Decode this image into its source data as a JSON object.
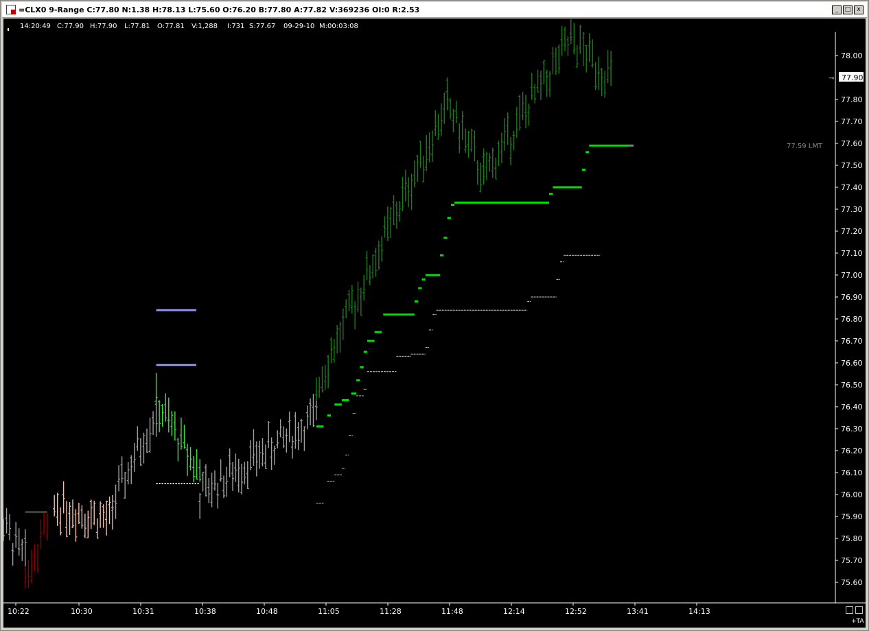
{
  "window": {
    "title": "=CLX0 9-Range C:77.80 N:1.38 H:78.13 L:75.60 O:76.20 B:77.80 A:77.82 V:369236 OI:0 R:2.53",
    "minimize_label": "_",
    "maximize_label": "□",
    "close_label": "x",
    "ta_label": "+TA"
  },
  "info_bar": {
    "time": "14:20:49",
    "close": "C:77.90",
    "high": "H:77.90",
    "low": "L:77.81",
    "open": "O:77.81",
    "volume": "V:1,288",
    "i": "I:731",
    "s": "S:77.67",
    "date": "09-29-10",
    "m": "M:00:03:08"
  },
  "chart_data": {
    "type": "ohlc-bar",
    "symbol": "CLX0",
    "ylim": [
      75.5,
      78.2
    ],
    "y_ticks": [
      "75.60",
      "75.70",
      "75.80",
      "75.90",
      "76.00",
      "76.10",
      "76.20",
      "76.30",
      "76.40",
      "76.50",
      "76.60",
      "76.70",
      "76.80",
      "76.90",
      "77.00",
      "77.10",
      "77.20",
      "77.30",
      "77.40",
      "77.50",
      "77.60",
      "77.70",
      "77.80",
      "78.00"
    ],
    "x_ticks": [
      "10:22",
      "10:30",
      "10:31",
      "10:38",
      "10:48",
      "11:05",
      "11:28",
      "11:48",
      "12:14",
      "12:52",
      "13:41",
      "14:13"
    ],
    "last_price": "77.90",
    "order_label": "77.59 LMT",
    "order_price": 77.59,
    "trend_segments": [
      {
        "color": "#8b0000",
        "start": 0.03,
        "end": 0.06,
        "from": 75.62,
        "to": 75.88
      },
      {
        "color": "#a0a0a0",
        "start": 0.0,
        "end": 0.03,
        "from": 75.85,
        "to": 75.7
      },
      {
        "color": "#f0c0b0",
        "start": 0.07,
        "end": 0.15,
        "from": 75.95,
        "to": 75.88
      },
      {
        "color": "#a0a0a0",
        "start": 0.15,
        "end": 0.21,
        "from": 75.95,
        "to": 76.38
      },
      {
        "color": "#40e040",
        "start": 0.21,
        "end": 0.27,
        "from": 76.42,
        "to": 76.1
      },
      {
        "color": "#a0a0a0",
        "start": 0.27,
        "end": 0.43,
        "from": 76.0,
        "to": 76.35
      },
      {
        "color": "#1e7a1e",
        "start": 0.43,
        "end": 0.61,
        "from": 76.5,
        "to": 77.78
      },
      {
        "color": "#1e7a1e",
        "start": 0.61,
        "end": 0.66,
        "from": 77.78,
        "to": 77.45
      },
      {
        "color": "#1e7a1e",
        "start": 0.66,
        "end": 0.78,
        "from": 77.45,
        "to": 78.07
      },
      {
        "color": "#1e7a1e",
        "start": 0.78,
        "end": 0.835,
        "from": 78.07,
        "to": 77.9
      }
    ],
    "stop_steps": [
      {
        "color": "#00e000",
        "x0": 0.43,
        "x1": 0.44,
        "y": 76.31
      },
      {
        "color": "#00e000",
        "x0": 0.445,
        "x1": 0.45,
        "y": 76.36
      },
      {
        "color": "#00e000",
        "x0": 0.455,
        "x1": 0.465,
        "y": 76.41
      },
      {
        "color": "#00e000",
        "x0": 0.465,
        "x1": 0.475,
        "y": 76.43
      },
      {
        "color": "#00e000",
        "x0": 0.478,
        "x1": 0.485,
        "y": 76.46
      },
      {
        "color": "#00e000",
        "x0": 0.485,
        "x1": 0.49,
        "y": 76.52
      },
      {
        "color": "#00e000",
        "x0": 0.49,
        "x1": 0.495,
        "y": 76.58
      },
      {
        "color": "#00e000",
        "x0": 0.495,
        "x1": 0.5,
        "y": 76.65
      },
      {
        "color": "#00e000",
        "x0": 0.5,
        "x1": 0.51,
        "y": 76.7
      },
      {
        "color": "#00e000",
        "x0": 0.51,
        "x1": 0.52,
        "y": 76.74
      },
      {
        "color": "#00e000",
        "x0": 0.522,
        "x1": 0.565,
        "y": 76.82
      },
      {
        "color": "#00e000",
        "x0": 0.565,
        "x1": 0.57,
        "y": 76.88
      },
      {
        "color": "#00e000",
        "x0": 0.57,
        "x1": 0.575,
        "y": 76.94
      },
      {
        "color": "#00e000",
        "x0": 0.575,
        "x1": 0.58,
        "y": 76.98
      },
      {
        "color": "#00e000",
        "x0": 0.58,
        "x1": 0.6,
        "y": 77.0
      },
      {
        "color": "#00e000",
        "x0": 0.6,
        "x1": 0.605,
        "y": 77.09
      },
      {
        "color": "#00e000",
        "x0": 0.605,
        "x1": 0.61,
        "y": 77.17
      },
      {
        "color": "#00e000",
        "x0": 0.61,
        "x1": 0.615,
        "y": 77.26
      },
      {
        "color": "#00e000",
        "x0": 0.615,
        "x1": 0.62,
        "y": 77.32
      },
      {
        "color": "#00e000",
        "x0": 0.62,
        "x1": 0.75,
        "y": 77.33
      },
      {
        "color": "#00e000",
        "x0": 0.75,
        "x1": 0.755,
        "y": 77.37
      },
      {
        "color": "#00e000",
        "x0": 0.755,
        "x1": 0.795,
        "y": 77.4
      },
      {
        "color": "#00e000",
        "x0": 0.795,
        "x1": 0.8,
        "y": 77.48
      },
      {
        "color": "#00e000",
        "x0": 0.8,
        "x1": 0.805,
        "y": 77.56
      },
      {
        "color": "#00e000",
        "x0": 0.805,
        "x1": 0.86,
        "y": 77.59
      }
    ],
    "white_steps": [
      {
        "x0": 0.43,
        "x1": 0.44,
        "y": 75.96
      },
      {
        "x0": 0.445,
        "x1": 0.455,
        "y": 76.06
      },
      {
        "x0": 0.455,
        "x1": 0.465,
        "y": 76.09
      },
      {
        "x0": 0.465,
        "x1": 0.47,
        "y": 76.12
      },
      {
        "x0": 0.47,
        "x1": 0.475,
        "y": 76.18
      },
      {
        "x0": 0.475,
        "x1": 0.48,
        "y": 76.27
      },
      {
        "x0": 0.48,
        "x1": 0.485,
        "y": 76.37
      },
      {
        "x0": 0.485,
        "x1": 0.495,
        "y": 76.45
      },
      {
        "x0": 0.495,
        "x1": 0.5,
        "y": 76.48
      },
      {
        "x0": 0.5,
        "x1": 0.54,
        "y": 76.56
      },
      {
        "x0": 0.54,
        "x1": 0.56,
        "y": 76.63
      },
      {
        "x0": 0.56,
        "x1": 0.58,
        "y": 76.64
      },
      {
        "x0": 0.58,
        "x1": 0.585,
        "y": 76.67
      },
      {
        "x0": 0.585,
        "x1": 0.59,
        "y": 76.75
      },
      {
        "x0": 0.59,
        "x1": 0.595,
        "y": 76.82
      },
      {
        "x0": 0.595,
        "x1": 0.72,
        "y": 76.84
      },
      {
        "x0": 0.72,
        "x1": 0.725,
        "y": 76.88
      },
      {
        "x0": 0.725,
        "x1": 0.76,
        "y": 76.9
      },
      {
        "x0": 0.76,
        "x1": 0.765,
        "y": 76.98
      },
      {
        "x0": 0.765,
        "x1": 0.77,
        "y": 77.06
      },
      {
        "x0": 0.77,
        "x1": 0.82,
        "y": 77.09
      }
    ],
    "markers": [
      {
        "color": "#9090ff",
        "x0": 0.21,
        "x1": 0.265,
        "y": 76.84
      },
      {
        "color": "#9090ff",
        "x0": 0.21,
        "x1": 0.265,
        "y": 76.59
      },
      {
        "color": "#404040",
        "x0": 0.03,
        "x1": 0.06,
        "y": 75.92
      }
    ],
    "x_marks": {
      "x0": 0.21,
      "x1": 0.27,
      "y": 76.05
    }
  }
}
